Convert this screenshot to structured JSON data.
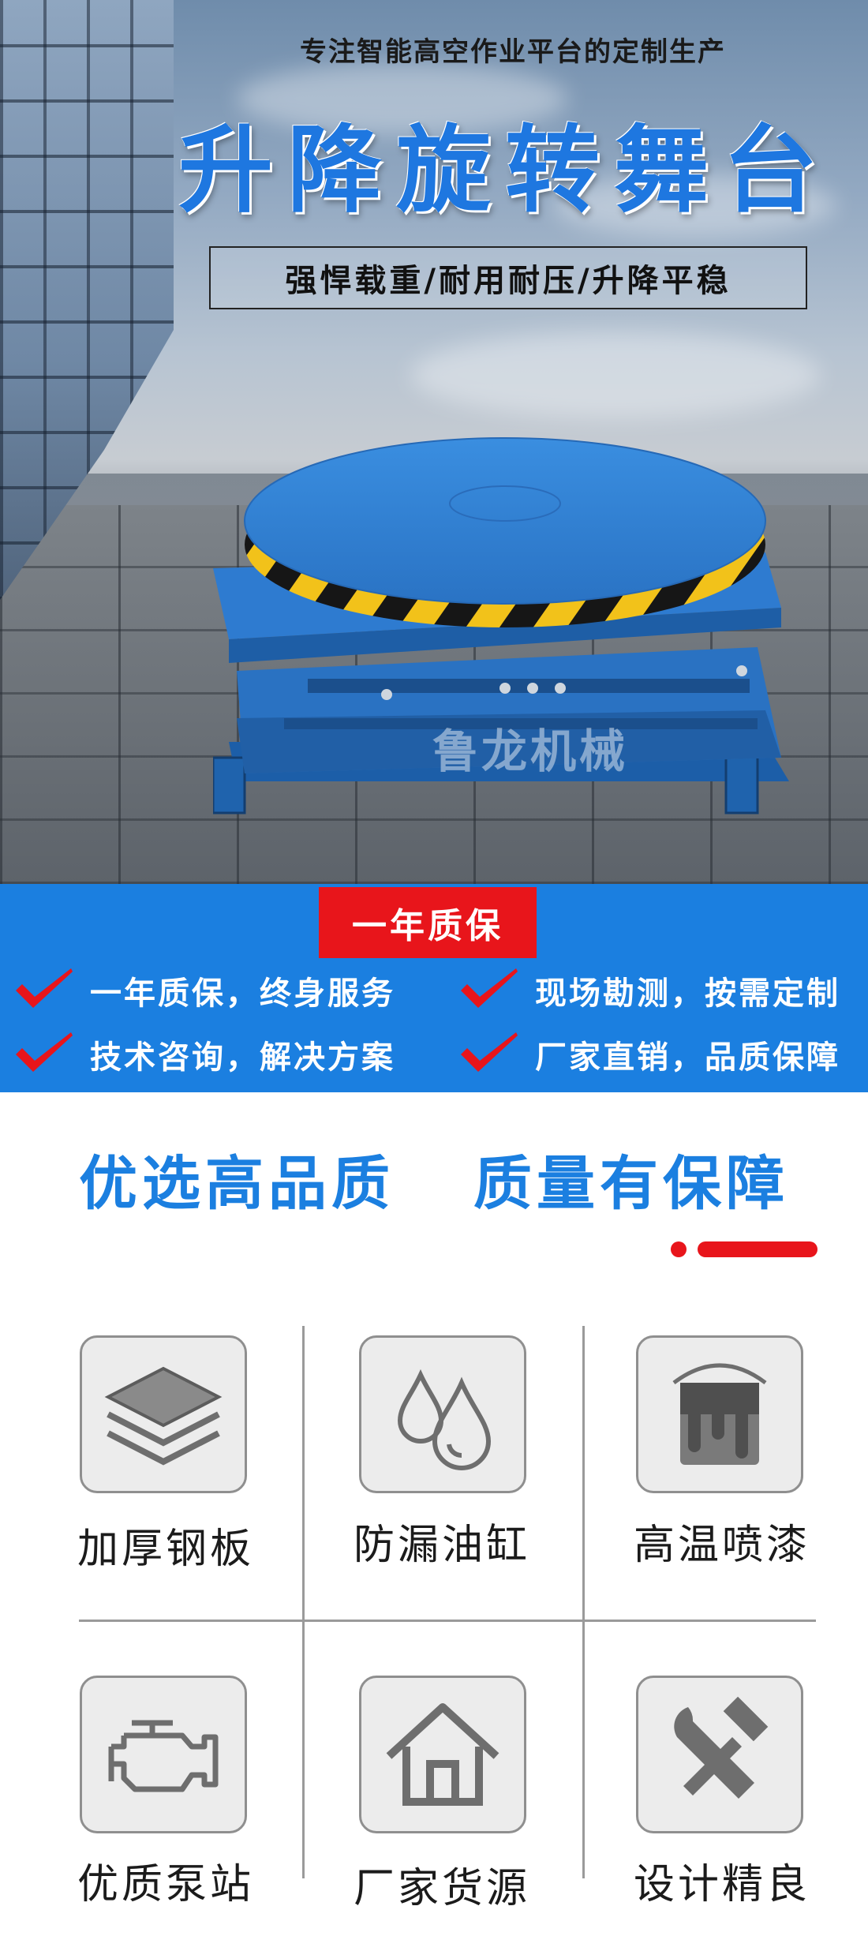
{
  "hero": {
    "subtitle": "专注智能高空作业平台的定制生产",
    "title": "升降旋转舞台",
    "features": "强悍载重/耐用耐压/升降平稳",
    "watermark": "鲁龙机械"
  },
  "warranty": {
    "badge": "一年质保",
    "promises": [
      "一年质保，终身服务",
      "现场勘测，按需定制",
      "技术咨询，解决方案",
      "厂家直销，品质保障"
    ]
  },
  "quality": {
    "left": "优选高品质",
    "right": "质量有保障"
  },
  "features": [
    {
      "label": "加厚钢板",
      "icon": "layers-icon"
    },
    {
      "label": "防漏油缸",
      "icon": "water-drops-icon"
    },
    {
      "label": "高温喷漆",
      "icon": "paint-bucket-icon"
    },
    {
      "label": "优质泵站",
      "icon": "engine-icon"
    },
    {
      "label": "厂家货源",
      "icon": "house-icon"
    },
    {
      "label": "设计精良",
      "icon": "wrench-hammer-icon"
    }
  ],
  "colors": {
    "accent_blue": "#1b7fe0",
    "accent_red": "#e8151b",
    "platform_blue": "#2f7fd2",
    "hazard_yellow": "#f2c21a"
  }
}
